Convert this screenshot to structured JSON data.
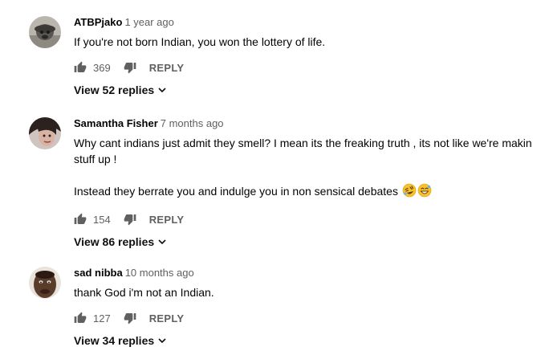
{
  "comments": [
    {
      "author": "ATBPjako",
      "time": "1 year ago",
      "text": [
        "If you're not born Indian, you won the lottery of life."
      ],
      "likes": "369",
      "reply_label": "REPLY",
      "view_replies": "View 52 replies",
      "avatar_color": "#6b6b6b"
    },
    {
      "author": "Samantha Fisher",
      "time": "7 months ago",
      "text": [
        "Why cant indians just admit they smell? I mean its the freaking truth , its not like  we're makin stuff up !",
        "Instead they berrate you and indulge you in non sensical debates"
      ],
      "emojis": [
        "rolling-on-floor-laughing-emoji",
        "grinning-sweat-emoji"
      ],
      "likes": "154",
      "reply_label": "REPLY",
      "view_replies": "View 86 replies",
      "avatar_color": "#8a7a78"
    },
    {
      "author": "sad nibba",
      "time": "10 months ago",
      "text": [
        "thank God i'm not an Indian."
      ],
      "likes": "127",
      "reply_label": "REPLY",
      "view_replies": "View 34 replies",
      "avatar_color": "#4a3428"
    }
  ],
  "colors": {
    "text": "#030303",
    "secondary": "#606060",
    "background": "#ffffff"
  },
  "icons": [
    "thumb-up-icon",
    "thumb-down-icon",
    "chevron-down-icon"
  ]
}
